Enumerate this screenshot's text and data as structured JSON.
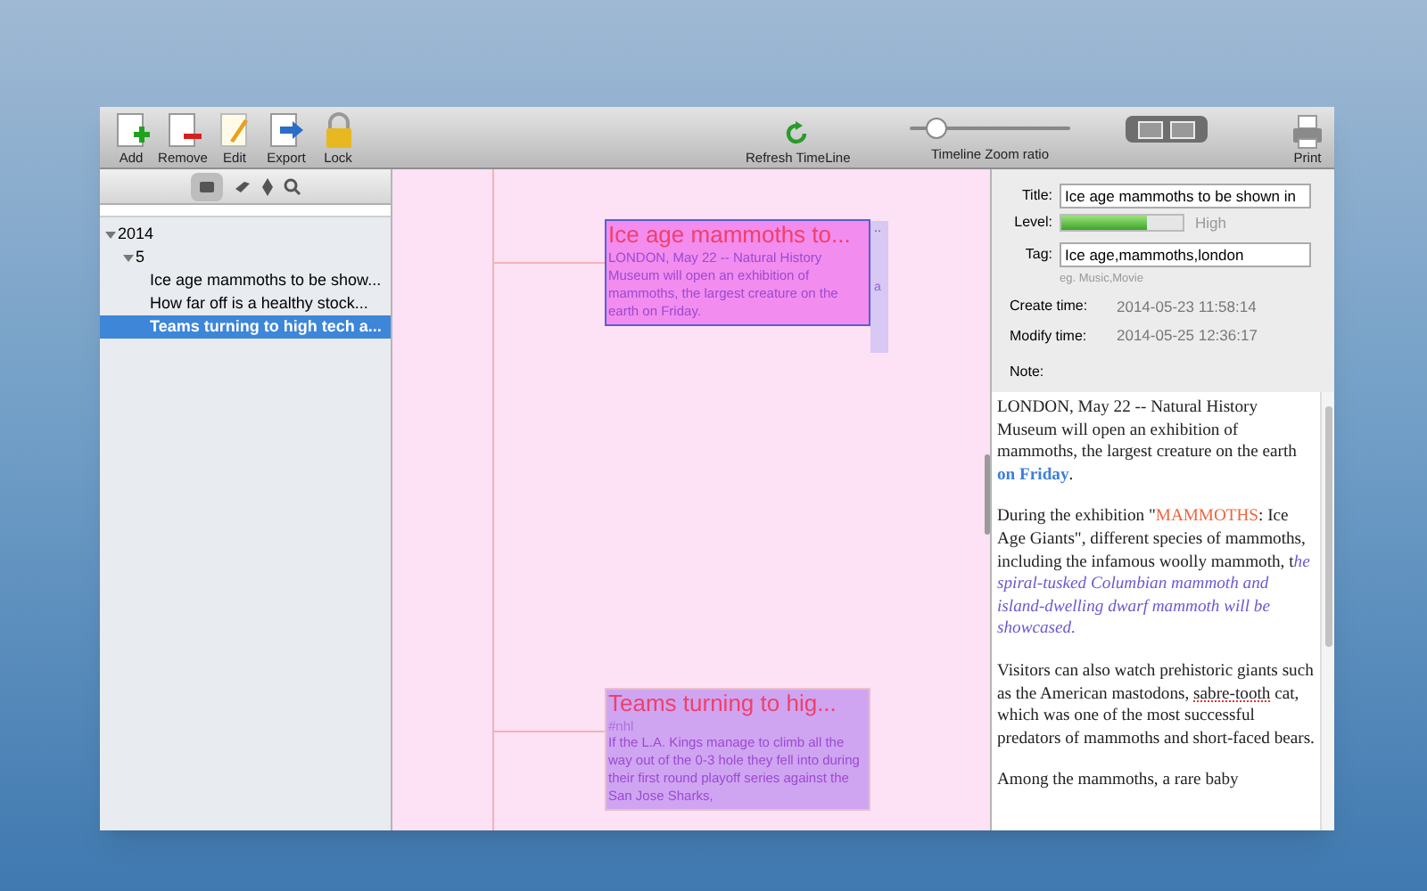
{
  "toolbar": {
    "left_buttons": [
      {
        "label": "Add",
        "kind": "add"
      },
      {
        "label": "Remove",
        "kind": "remove"
      },
      {
        "label": "Edit",
        "kind": "edit"
      },
      {
        "label": "Export",
        "kind": "export"
      },
      {
        "label": "Lock",
        "kind": "lock"
      }
    ],
    "refresh": {
      "label": "Refresh TimeLine"
    },
    "zoom_slider": {
      "label": "Timeline Zoom ratio",
      "level": 0.17
    },
    "print": {
      "label": "Print"
    }
  },
  "sidebar": {
    "tree": [
      {
        "label": "2014",
        "expanded": true,
        "children": [
          {
            "label": "5",
            "expanded": true,
            "children": [
              {
                "label": "Ice age mammoths to be show...",
                "selected": false
              },
              {
                "label": "How far off is a healthy stock...",
                "selected": false
              },
              {
                "label": "Teams turning to high tech a...",
                "selected": true
              }
            ]
          }
        ]
      }
    ]
  },
  "timeline": {
    "cards": [
      {
        "title": "Ice age mammoths to...",
        "body": "LONDON, May 22  -- Natural History Museum will open an exhibition of mammoths, the largest creature on the earth on Friday.",
        "selected": true,
        "behind": {
          "text": "a",
          "ellipsis": ".."
        }
      },
      {
        "title": "Teams turning to hig...",
        "tag": "#nhl",
        "body": "If the L.A. Kings manage to climb all the way out of the 0-3 hole they fell into during their first round playoff series against the San Jose Sharks,",
        "selected": false
      }
    ]
  },
  "details": {
    "title_label": "Title:",
    "title_value": "Ice age mammoths to be shown in",
    "level_label": "Level:",
    "level": 0.7,
    "level_text": "High",
    "tag_label": "Tag:",
    "tag_value": "Ice age,mammoths,london",
    "tag_hint": "eg. Music,Movie",
    "create_label": "Create time:",
    "create_value": "2014-05-23 11:58:14",
    "modify_label": "Modify time:",
    "modify_value": "2014-05-25 12:36:17",
    "note_label": "Note:"
  },
  "note": [
    [
      {
        "kind": "plain",
        "text": "LONDON, May 22  -- Natural History Museum will open an exhibition of mammoths, the largest creature on the earth "
      },
      {
        "kind": "link",
        "text": "on Friday"
      },
      {
        "kind": "plain",
        "text": "."
      }
    ],
    [
      {
        "kind": "plain",
        "text": "During the exhibition \""
      },
      {
        "kind": "red",
        "text": "MAMMOTHS"
      },
      {
        "kind": "plain",
        "text": ": Ice Age Giants\", different species of mammoths, including the infamous woolly mammoth, t"
      },
      {
        "kind": "italic",
        "text": "he spiral-tusked Columbian mammoth and island-dwelling dwarf mammoth will be showcased."
      }
    ],
    [
      {
        "kind": "plain",
        "text": "Visitors can also watch prehistoric giants such as the American mastodons, "
      },
      {
        "kind": "misspelled",
        "text": "sabre-tooth"
      },
      {
        "kind": "plain",
        "text": " cat, which was one of the most successful predators of mammoths and short-faced bears."
      }
    ],
    [
      {
        "kind": "plain",
        "text": "Among the mammoths, a rare baby"
      }
    ]
  ]
}
